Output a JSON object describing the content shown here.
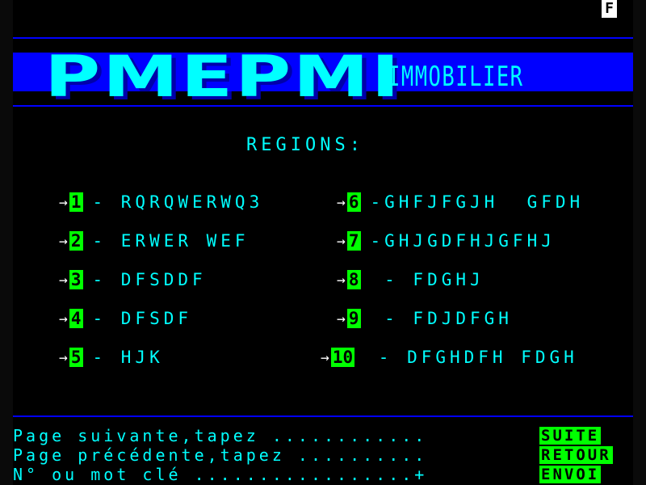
{
  "header": {
    "status_char": "F",
    "logo": "PMEPMI",
    "subtitle": "IMMOBILIER"
  },
  "regions": {
    "title": "REGIONS:",
    "left": [
      {
        "num": "1",
        "label": "- RQRQWERWQ3"
      },
      {
        "num": "2",
        "label": "- ERWER WEF"
      },
      {
        "num": "3",
        "label": "- DFSDDF"
      },
      {
        "num": "4",
        "label": "- DFSDF"
      },
      {
        "num": "5",
        "label": "- HJK"
      }
    ],
    "right": [
      {
        "num": "6",
        "label": "-GHFJFGJH  GFDH"
      },
      {
        "num": "7",
        "label": "-GHJGDFHJGFHJ"
      },
      {
        "num": "8",
        "label": " - FDGHJ"
      },
      {
        "num": "9",
        "label": " - FDJDFGH"
      },
      {
        "num": "10",
        "label": " - DFGHDFH FDGH"
      }
    ]
  },
  "footer": {
    "next_text": "Page suivante,tapez ............",
    "prev_text": "Page précédente,tapez ..........",
    "search_text": "N° ou mot clé .................+",
    "next_key": "SUITE",
    "prev_key": "RETOUR",
    "send_key": "ENVOI"
  },
  "colors": {
    "banner": "#0000ff",
    "text": "#00ffff",
    "key_bg": "#00ff00"
  }
}
